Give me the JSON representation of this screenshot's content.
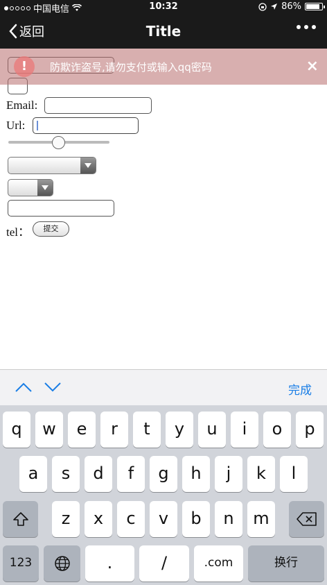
{
  "status_bar": {
    "carrier": "中国电信",
    "time": "10:32",
    "battery": "86%",
    "battery_level": 0.86,
    "signal_dots_filled": 1,
    "signal_dots_total": 5
  },
  "nav": {
    "back_label": "返回",
    "title": "Title"
  },
  "toast": {
    "icon_glyph": "!",
    "message": "防欺诈盗号,请勿支付或输入qq密码",
    "close_glyph": "×"
  },
  "form": {
    "email_label": "Email:",
    "url_label": "Url:",
    "tel_label": "tel：",
    "submit_label": "提交",
    "range_value": 0.5
  },
  "accessory": {
    "done_label": "完成"
  },
  "keyboard": {
    "row1": [
      "q",
      "w",
      "e",
      "r",
      "t",
      "y",
      "u",
      "i",
      "o",
      "p"
    ],
    "row2": [
      "a",
      "s",
      "d",
      "f",
      "g",
      "h",
      "j",
      "k",
      "l"
    ],
    "row3": [
      "z",
      "x",
      "c",
      "v",
      "b",
      "n",
      "m"
    ],
    "numbers_key": "123",
    "dot_key": ".",
    "slash_key": "/",
    "dotcom_key": ".com",
    "return_key": "换行"
  },
  "colors": {
    "bar_bg": "#1a1a1a",
    "toast_bg": "#b86e6e",
    "accent": "#1a7ee6",
    "keyboard_bg": "#d1d4da"
  }
}
